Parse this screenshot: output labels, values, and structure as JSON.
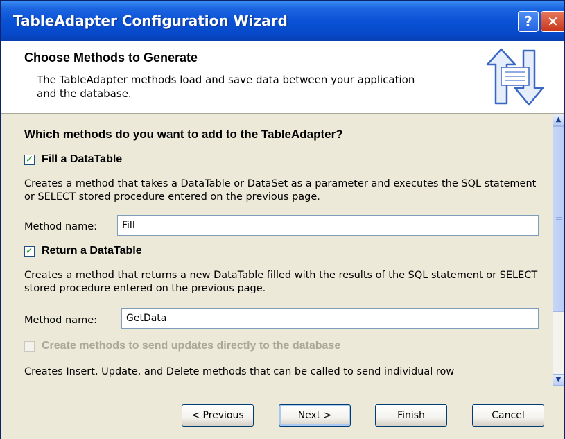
{
  "window": {
    "title": "TableAdapter Configuration Wizard",
    "help_glyph": "?",
    "close_glyph": "✕"
  },
  "header": {
    "title": "Choose Methods to Generate",
    "description": "The TableAdapter methods load and save data between your application and the database.",
    "icon": "data-transfer-arrows-icon"
  },
  "content": {
    "question": "Which methods do you want to add to the TableAdapter?",
    "fill_option": {
      "label": "Fill a DataTable",
      "checked": true,
      "description": "Creates a method that takes a DataTable or DataSet as a parameter and executes the SQL statement or SELECT stored procedure entered on the previous page.",
      "method_label": "Method name:",
      "method_value": "Fill"
    },
    "return_option": {
      "label": "Return a DataTable",
      "checked": true,
      "description": "Creates a method that returns a new DataTable filled with the results of the SQL statement or SELECT stored procedure entered on the previous page.",
      "method_label": "Method name:",
      "method_value": "GetData"
    },
    "update_option": {
      "label": "Create methods to send updates directly to the database",
      "checked": false,
      "enabled": false,
      "description": "Creates Insert, Update, and Delete methods that can be called to send individual row"
    },
    "check_glyph": "✓"
  },
  "footer": {
    "previous_label": "< Previous",
    "next_label": "Next >",
    "finish_label": "Finish",
    "cancel_label": "Cancel"
  },
  "colors": {
    "titlebar": "#0a52d6",
    "window_bg": "#ece9d8",
    "checkmark": "#21a121"
  }
}
